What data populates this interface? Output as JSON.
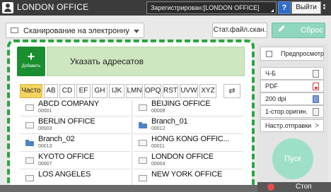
{
  "header": {
    "title": "LONDON OFFICE",
    "status": "Зарегистрирован:[LONDON OFFICE]",
    "help_label": "?",
    "logout_label": "Выйти"
  },
  "toolbar": {
    "function_label": "Сканирование на электронную",
    "stored_file_label": "Стат.файл.скан.",
    "reset_label": "Сброс"
  },
  "destination": {
    "add_label": "Добавить",
    "add_symbol": "+",
    "specify_label": "Указать адресатов"
  },
  "tabs": [
    "Часто",
    "AB",
    "CD",
    "EF",
    "GH",
    "IJK",
    "LMN",
    "OPQ",
    "RST",
    "UVW",
    "XYZ"
  ],
  "tab_refresh_symbol": "⇄",
  "entries": [
    {
      "name": "ABCD COMPANY",
      "number": "00001",
      "icon": "mail-icon"
    },
    {
      "name": "BEIJING OFFICE",
      "number": "00008",
      "icon": "mail-icon"
    },
    {
      "name": "BERLIN OFFICE",
      "number": "00003",
      "icon": "mail-icon"
    },
    {
      "name": "Branch_01",
      "number": "00012",
      "icon": "folder-icon"
    },
    {
      "name": "Branch_02",
      "number": "00013",
      "icon": "folder-icon"
    },
    {
      "name": "HONG KONG OFFIC...",
      "number": "00011",
      "icon": "mail-icon"
    },
    {
      "name": "KYOTO OFFICE",
      "number": "00007",
      "icon": "mail-icon"
    },
    {
      "name": "LONDON OFFICE",
      "number": "00004",
      "icon": "mail-icon"
    },
    {
      "name": "LOS ANGELES",
      "number": "",
      "icon": "mail-icon"
    },
    {
      "name": "NEW YORK OFFICE",
      "number": "",
      "icon": "mail-icon"
    }
  ],
  "settings": {
    "preview_label": "Предпросмотр",
    "color_mode": "Ч-Б",
    "file_type": "PDF",
    "resolution": "200 dpi",
    "original_side": "1-стор.оригин.",
    "send_settings": "Настр.отправки",
    "send_arrow": ">"
  },
  "actions": {
    "start_label": "Пуск",
    "stop_label": "Стоп"
  },
  "colors": {
    "accent_green": "#1b8f30",
    "dashed_border": "#2aa43e",
    "active_tab": "#f4d35e",
    "reset_bg": "#8fd6bf",
    "start_bg": "#9ee0c7"
  }
}
